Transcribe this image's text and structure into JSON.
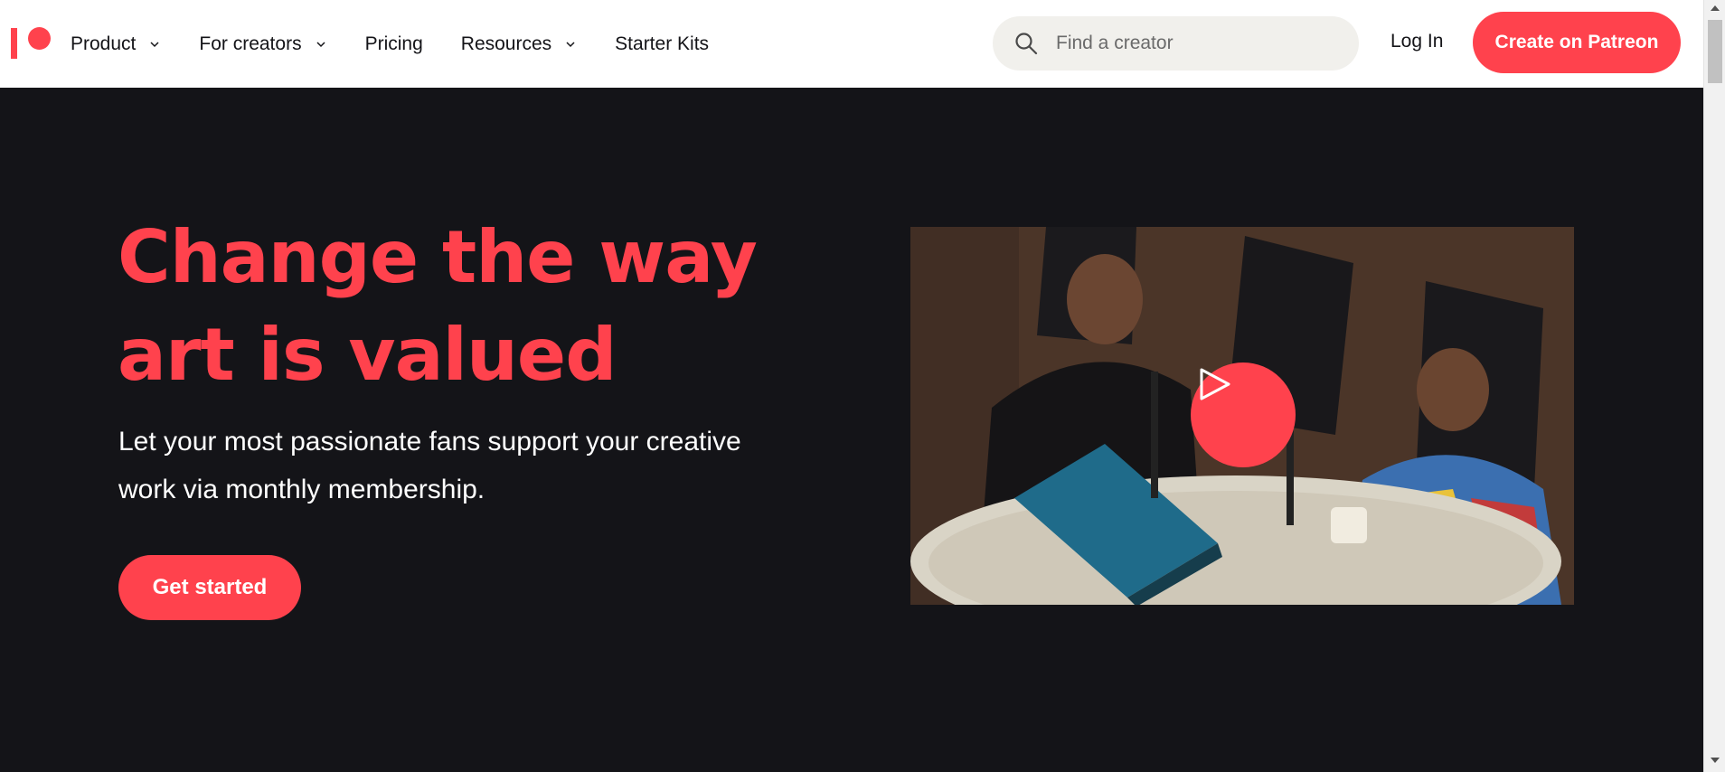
{
  "nav": {
    "logo_alt": "Patreon",
    "items": [
      {
        "label": "Product",
        "has_dropdown": true
      },
      {
        "label": "For creators",
        "has_dropdown": true
      },
      {
        "label": "Pricing",
        "has_dropdown": false
      },
      {
        "label": "Resources",
        "has_dropdown": true
      },
      {
        "label": "Starter Kits",
        "has_dropdown": false
      }
    ],
    "search_placeholder": "Find a creator",
    "search_icon": "search-icon",
    "login_label": "Log In",
    "cta_label": "Create on Patreon"
  },
  "hero": {
    "headline_line1": "Change the way",
    "headline_line2": "art is valued",
    "subtext_line1": "Let your most passionate fans support your creative",
    "subtext_line2": "work via monthly membership.",
    "button_label": "Get started",
    "video_play_icon": "play-icon"
  },
  "colors": {
    "brand": "#ff424d",
    "hero_bg": "#141418",
    "nav_bg": "#ffffff",
    "search_bg": "#f1f0ec"
  }
}
